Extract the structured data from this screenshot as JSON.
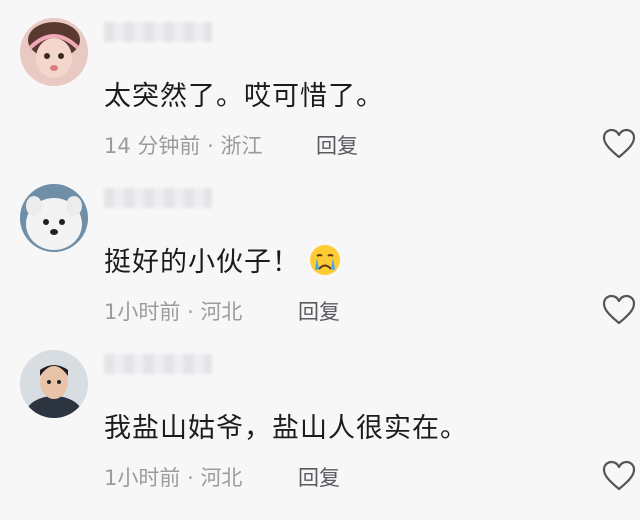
{
  "comments": [
    {
      "username": "",
      "text": "太突然了。哎可惜了。",
      "time": "14 分钟前",
      "location": "浙江",
      "reply_label": "回复",
      "emoji": "",
      "avatar_icon": "baby-girl-avatar"
    },
    {
      "username": "",
      "text": "挺好的小伙子！",
      "time": "1小时前",
      "location": "河北",
      "reply_label": "回复",
      "emoji": "crying-face-emoji",
      "avatar_icon": "white-dog-avatar"
    },
    {
      "username": "",
      "text": "我盐山姑爷，盐山人很实在。",
      "time": "1小时前",
      "location": "河北",
      "reply_label": "回复",
      "emoji": "",
      "avatar_icon": "man-portrait-avatar"
    }
  ],
  "separator": "·",
  "colors": {
    "background": "#f7f7f8",
    "text": "#1c1c1e",
    "meta": "#9b9ba0",
    "reply": "#5a5a60",
    "heart_outline": "#555555"
  }
}
